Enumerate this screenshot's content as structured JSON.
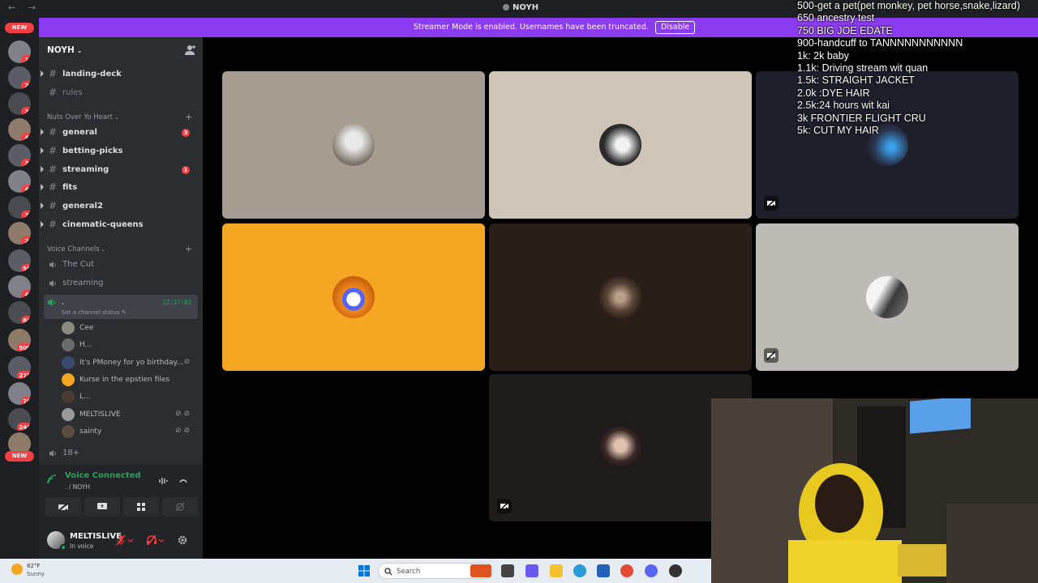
{
  "titlebar": {
    "nav": "← →",
    "title": "NOYH"
  },
  "banner": {
    "message": "Streamer Mode is enabled. Usernames have been truncated.",
    "button": "Disable",
    "close": "×"
  },
  "rail": {
    "new_label": "NEW",
    "badges": [
      "1",
      "2",
      "3",
      "4",
      "3",
      "4",
      "3",
      "2",
      "50",
      "4",
      "84",
      "500",
      "275",
      "78",
      "245"
    ]
  },
  "server": {
    "name": "NOYH"
  },
  "channels": [
    {
      "name": "landing-deck",
      "muted": false,
      "unread": ""
    },
    {
      "name": "rules",
      "muted": true,
      "unread": ""
    }
  ],
  "category1": {
    "name": "Nuts Over Yo Heart",
    "add": "+"
  },
  "channels2": [
    {
      "name": "general",
      "unread": "3"
    },
    {
      "name": "betting-picks",
      "unread": ""
    },
    {
      "name": "streaming",
      "unread": "1"
    },
    {
      "name": "fits",
      "unread": ""
    },
    {
      "name": "general2",
      "unread": ""
    },
    {
      "name": "cinematic-queens",
      "unread": ""
    }
  ],
  "category2": {
    "name": "Voice Channels",
    "add": "+"
  },
  "voice_channels": [
    {
      "name": "The Cut"
    },
    {
      "name": "streaming"
    }
  ],
  "current_voice": {
    "name": ".",
    "time": "12:37:02",
    "status": "Set a channel status"
  },
  "members": [
    {
      "name": "Cee"
    },
    {
      "name": "H..."
    },
    {
      "name": "It's PMoney for yo birthday..."
    },
    {
      "name": "Kurse in the epstien files"
    },
    {
      "name": "L..."
    },
    {
      "name": "MELTISLIVE"
    },
    {
      "name": "sainty"
    }
  ],
  "voice_18": {
    "name": "18+"
  },
  "voice_panel": {
    "title": "Voice Connected",
    "sub": ". / NOYH"
  },
  "user": {
    "name": "MELTISLIVE",
    "status": "In voice"
  },
  "overlay_goals": [
    "500-get a pet(pet monkey, pet horse,snake,lizard)",
    "650 ancestry test",
    "750 BIG JOE EDATE",
    "900-handcuff to TANNNNNNNNNNN",
    "1k: 2k baby",
    "1.1k: Driving stream wit quan",
    "1.5k: STRAIGHT JACKET",
    "2.0k :DYE HAIR",
    "2.5k:24 hours wit kai",
    "3k FRONTIER FLIGHT CRU",
    "5k: CUT MY HAIR"
  ],
  "taskbar": {
    "weather_temp": "82°F",
    "weather_cond": "Sunny",
    "search_placeholder": "Search"
  },
  "colors": {
    "accent": "#8b3cf0",
    "online": "#23a55a",
    "badge": "#f23f43",
    "tile_orange": "#f5a623"
  }
}
